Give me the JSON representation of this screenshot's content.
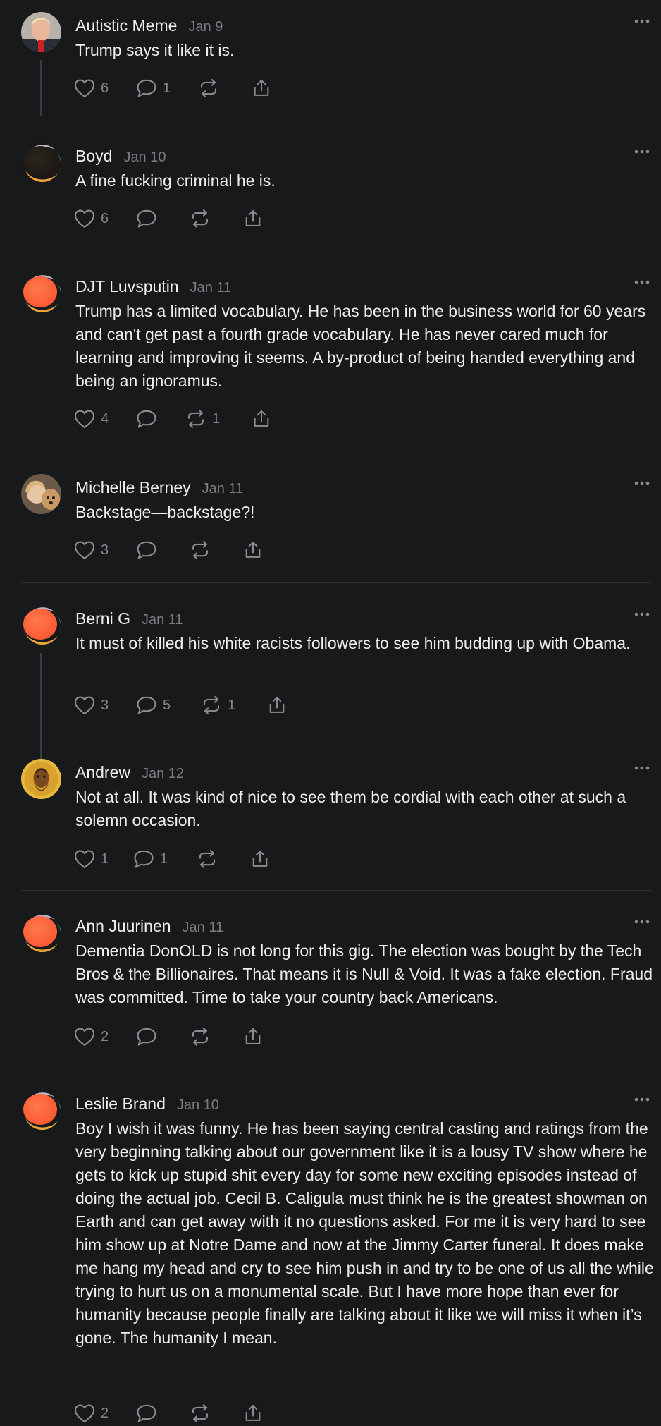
{
  "comments": [
    {
      "name": "Autistic Meme",
      "date": "Jan 9",
      "text": "Trump says it like it is.",
      "likes": "6",
      "replies": "1",
      "reposts": "",
      "avatar": "photo-portrait"
    },
    {
      "name": "Boyd",
      "date": "Jan 10",
      "text": "A fine fucking criminal he is.",
      "likes": "6",
      "replies": "",
      "reposts": "",
      "avatar": "dark-gradient"
    },
    {
      "name": "DJT Luvsputin",
      "date": "Jan 11",
      "text": "Trump has a limited vocabulary. He has been in the business world for 60 years and can't get past a fourth grade vocabulary. He has never cared much for learning and improving it seems. A by-product of being handed everything and being an ignoramus.",
      "likes": "4",
      "replies": "",
      "reposts": "1",
      "avatar": "orange-gradient"
    },
    {
      "name": "Michelle Berney",
      "date": "Jan 11",
      "text": "Backstage—backstage?!",
      "likes": "3",
      "replies": "",
      "reposts": "",
      "avatar": "photo-woman-dog"
    },
    {
      "name": "Berni G",
      "date": "Jan 11",
      "text": "It must of killed his white racists followers to see him budding up with Obama.",
      "likes": "3",
      "replies": "5",
      "reposts": "1",
      "avatar": "orange-gradient"
    },
    {
      "name": "Andrew",
      "date": "Jan 12",
      "text": "Not at all. It was kind of nice to see them be cordial with each other at such a solemn occasion.",
      "likes": "1",
      "replies": "1",
      "reposts": "",
      "avatar": "icon-painting"
    },
    {
      "name": "Ann Juurinen",
      "date": "Jan 11",
      "text": "Dementia DonOLD is not long for this gig. The election was bought by the Tech Bros & the Billionaires. That means it is Null & Void. It was a fake election. Fraud was committed. Time to take your country back Americans.",
      "likes": "2",
      "replies": "",
      "reposts": "",
      "avatar": "orange-gradient"
    },
    {
      "name": "Leslie Brand",
      "date": "Jan 10",
      "text": "Boy I wish it was funny. He has been saying central casting and ratings from the very beginning talking about our government like it is a lousy TV show where he gets to kick up stupid shit every day for some new exciting episodes instead of doing the actual job. Cecil B. Caligula must think he is the greatest showman on Earth and can get away with it no questions asked. For me it is very hard to see him show up at Notre Dame and now at the Jimmy Carter funeral. It does make me hang my head and cry to see him push in and try to be one of us all the while trying to hurt us on a monumental scale. But I have more hope than ever for humanity because people finally are talking about it like we will miss it when it’s gone. The humanity I mean.",
      "likes": "2",
      "replies": "",
      "reposts": "",
      "avatar": "orange-gradient"
    }
  ],
  "colors": {
    "background": "#18191b",
    "text": "#eeeeef",
    "muted": "#7c7d82",
    "divider": "#2b2c2f",
    "icon": "#8b8c91",
    "avatar_orange": "#ff6a3d"
  },
  "icons": [
    "heart-icon",
    "comment-icon",
    "repost-icon",
    "share-icon",
    "more-icon"
  ]
}
